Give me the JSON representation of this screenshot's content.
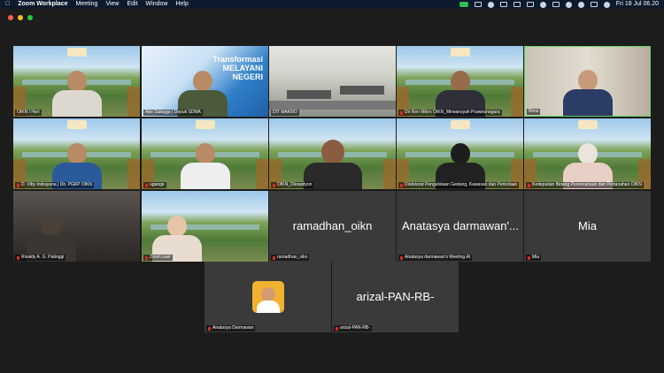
{
  "menubar": {
    "app_name": "Zoom Workplace",
    "menus": [
      "Meeting",
      "View",
      "Edit",
      "Window",
      "Help"
    ],
    "datetime": "Fri 18 Jul 06.20"
  },
  "tiles": [
    {
      "label": "OIKN I Heri",
      "muted": false
    },
    {
      "label": "Abe Subagja | Deputi SDMA",
      "muted": false,
      "banner": "Transformasi MELAYANI NEGERI"
    },
    {
      "label": "DIT MAKRO",
      "muted": false
    },
    {
      "label": "Dir Ren Mikro OIKN_Mirwansyah Prawiranegara",
      "muted": true
    },
    {
      "label": "Bimo",
      "muted": false
    },
    {
      "label": "D. Viby Indrayana | Dir. PGKP OIKN",
      "muted": true
    },
    {
      "label": "ugange",
      "muted": true
    },
    {
      "label": "OIKN_Dkowidyon",
      "muted": true
    },
    {
      "label": "Direktorat Pengelolaan Gedung, Kawasan dan Perkotaan",
      "muted": true
    },
    {
      "label": "Kedeputian Bidang Perencanaan dan Pertanahan OIKN",
      "muted": true
    },
    {
      "label": "Rivaldy A. G. Patinggi",
      "muted": true
    },
    {
      "label": "Zoom user",
      "muted": true
    },
    {
      "label": "ramadhan_oikn",
      "muted": true,
      "display_name": "ramadhan_oikn"
    },
    {
      "label": "Anatasya darmawan's Meeting.AI",
      "muted": true,
      "display_name": "Anatasya darmawan'..."
    },
    {
      "label": "Mia",
      "muted": true,
      "display_name": "Mia"
    },
    {
      "label": "Anatasya Darmawan",
      "muted": true
    },
    {
      "label": "arizal-PAN-RB-",
      "muted": true,
      "display_name": "arizal-PAN-RB-"
    }
  ]
}
